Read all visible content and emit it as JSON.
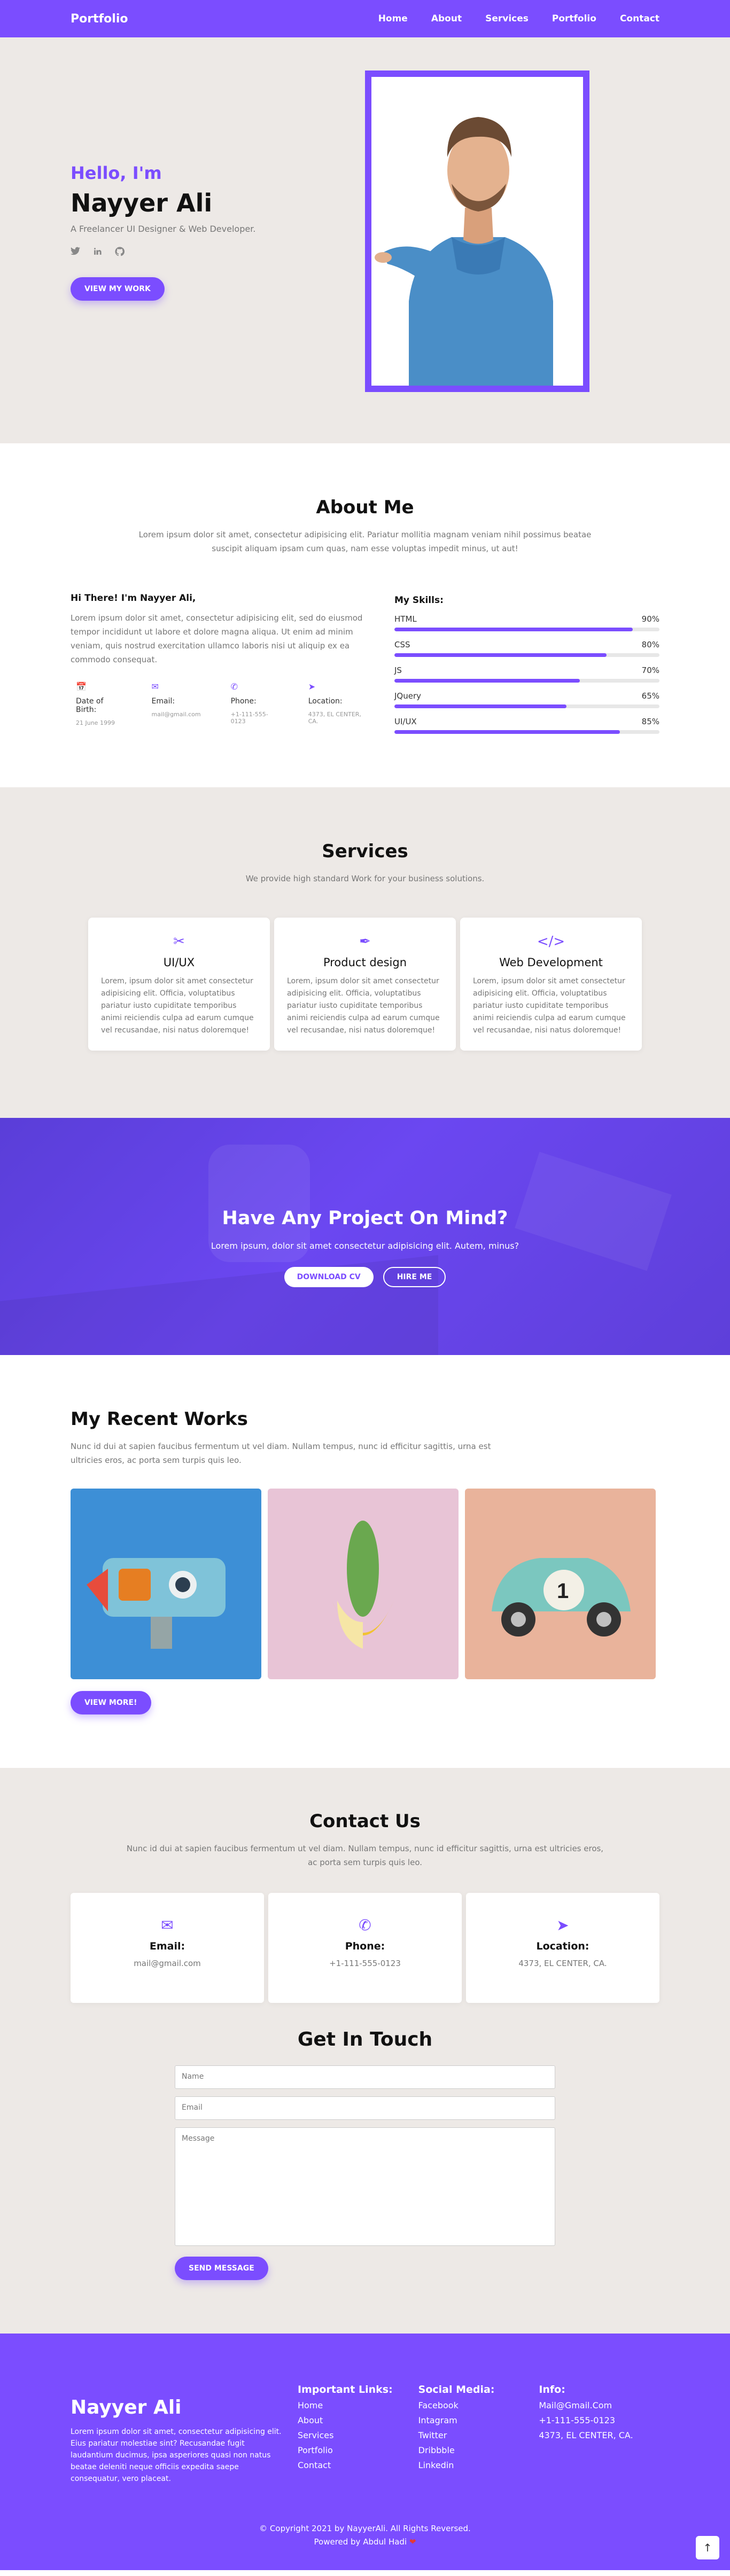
{
  "nav": {
    "brand": "Portfolio",
    "links": [
      "Home",
      "About",
      "Services",
      "Portfolio",
      "Contact"
    ]
  },
  "hero": {
    "hello": "Hello, I'm",
    "name": "Nayyer Ali",
    "tagline": "A Freelancer UI Designer & Web Developer.",
    "social_icons": [
      "twitter-icon",
      "linkedin-icon",
      "github-icon"
    ],
    "button": "VIEW MY WORK"
  },
  "about": {
    "title": "About Me",
    "subtitle": "Lorem ipsum dolor sit amet, consectetur adipisicing elit. Pariatur mollitia magnam veniam nihil possimus beatae suscipit aliquam ipsam cum quas, nam esse voluptas impedit minus, ut aut!",
    "greeting": "Hi There! I'm Nayyer Ali,",
    "bio": "Lorem ipsum dolor sit amet, consectetur adipisicing elit, sed do eiusmod tempor incididunt ut labore et dolore magna aliqua. Ut enim ad minim veniam, quis nostrud exercitation ullamco laboris nisi ut aliquip ex ea commodo consequat.",
    "info": [
      {
        "icon": "calendar-icon",
        "label": "Date of Birth:",
        "value": "21 June 1999"
      },
      {
        "icon": "envelope-icon",
        "label": "Email:",
        "value": "mail@gmail.com"
      },
      {
        "icon": "phone-icon",
        "label": "Phone:",
        "value": "+1-111-555-0123"
      },
      {
        "icon": "location-arrow-icon",
        "label": "Location:",
        "value": "4373, EL CENTER, CA."
      }
    ],
    "skills_title": "My Skills:",
    "skills": [
      {
        "name": "HTML",
        "level": "90%"
      },
      {
        "name": "CSS",
        "level": "80%"
      },
      {
        "name": "JS",
        "level": "70%"
      },
      {
        "name": "JQuery",
        "level": "65%"
      },
      {
        "name": "UI/UX",
        "level": "85%"
      }
    ]
  },
  "services": {
    "title": "Services",
    "subtitle": "We provide high standard Work for your business solutions.",
    "items": [
      {
        "icon": "crop-icon",
        "title": "UI/UX",
        "text": "Lorem, ipsum dolor sit amet consectetur adipisicing elit. Officia, voluptatibus pariatur iusto cupiditate temporibus animi reiciendis culpa ad earum cumque vel recusandae, nisi natus doloremque!"
      },
      {
        "icon": "pen-nib-icon",
        "title": "Product design",
        "text": "Lorem, ipsum dolor sit amet consectetur adipisicing elit. Officia, voluptatibus pariatur iusto cupiditate temporibus animi reiciendis culpa ad earum cumque vel recusandae, nisi natus doloremque!"
      },
      {
        "icon": "code-icon",
        "title": "Web Development",
        "text": "Lorem, ipsum dolor sit amet consectetur adipisicing elit. Officia, voluptatibus pariatur iusto cupiditate temporibus animi reiciendis culpa ad earum cumque vel recusandae, nisi natus doloremque!"
      }
    ]
  },
  "cta": {
    "title": "Have Any Project On Mind?",
    "text": "Lorem ipsum, dolor sit amet consectetur adipisicing elit. Autem, minus?",
    "download": "DOWNLOAD CV",
    "hire": "HIRE ME"
  },
  "works": {
    "title": "My Recent Works",
    "text": "Nunc id dui at sapien faucibus fermentum ut vel diam. Nullam tempus, nunc id efficitur sagittis, urna est ultricies eros, ac porta sem turpis quis leo.",
    "button": "VIEW MORE!"
  },
  "contact": {
    "title": "Contact Us",
    "subtitle": "Nunc id dui at sapien faucibus fermentum ut vel diam. Nullam tempus, nunc id efficitur sagittis, urna est ultricies eros, ac porta sem turpis quis leo.",
    "cards": [
      {
        "icon": "envelope-icon",
        "label": "Email:",
        "value": "mail@gmail.com"
      },
      {
        "icon": "phone-icon",
        "label": "Phone:",
        "value": "+1-111-555-0123"
      },
      {
        "icon": "location-arrow-icon",
        "label": "Location:",
        "value": "4373, EL CENTER, CA."
      }
    ],
    "form_title": "Get In Touch",
    "name_placeholder": "Name",
    "email_placeholder": "Email",
    "message_placeholder": "Message",
    "send": "SEND MESSAGE"
  },
  "footer": {
    "brand": "Nayyer Ali",
    "text": "Lorem ipsum dolor sit amet, consectetur adipisicing elit. Eius pariatur molestiae sint? Recusandae fugit laudantium ducimus, ipsa asperiores quasi non natus beatae deleniti neque officiis expedita saepe consequatur, vero placeat.",
    "links_title": "Important Links:",
    "links": [
      "Home",
      "About",
      "Services",
      "Portfolio",
      "Contact"
    ],
    "social_title": "Social Media:",
    "social": [
      "Facebook",
      "Intagram",
      "Twitter",
      "Dribbble",
      "Linkedin"
    ],
    "info_title": "Info:",
    "info": [
      "Mail@Gmail.Com",
      "+1-111-555-0123",
      "4373, EL CENTER, CA."
    ],
    "copyright": "© Copyright 2021 by NayyerAli. All Rights Reversed.",
    "powered": "Powered by Abdul Hadi"
  },
  "colors": {
    "accent": "#7b4dff",
    "background": "#ede9e6"
  }
}
